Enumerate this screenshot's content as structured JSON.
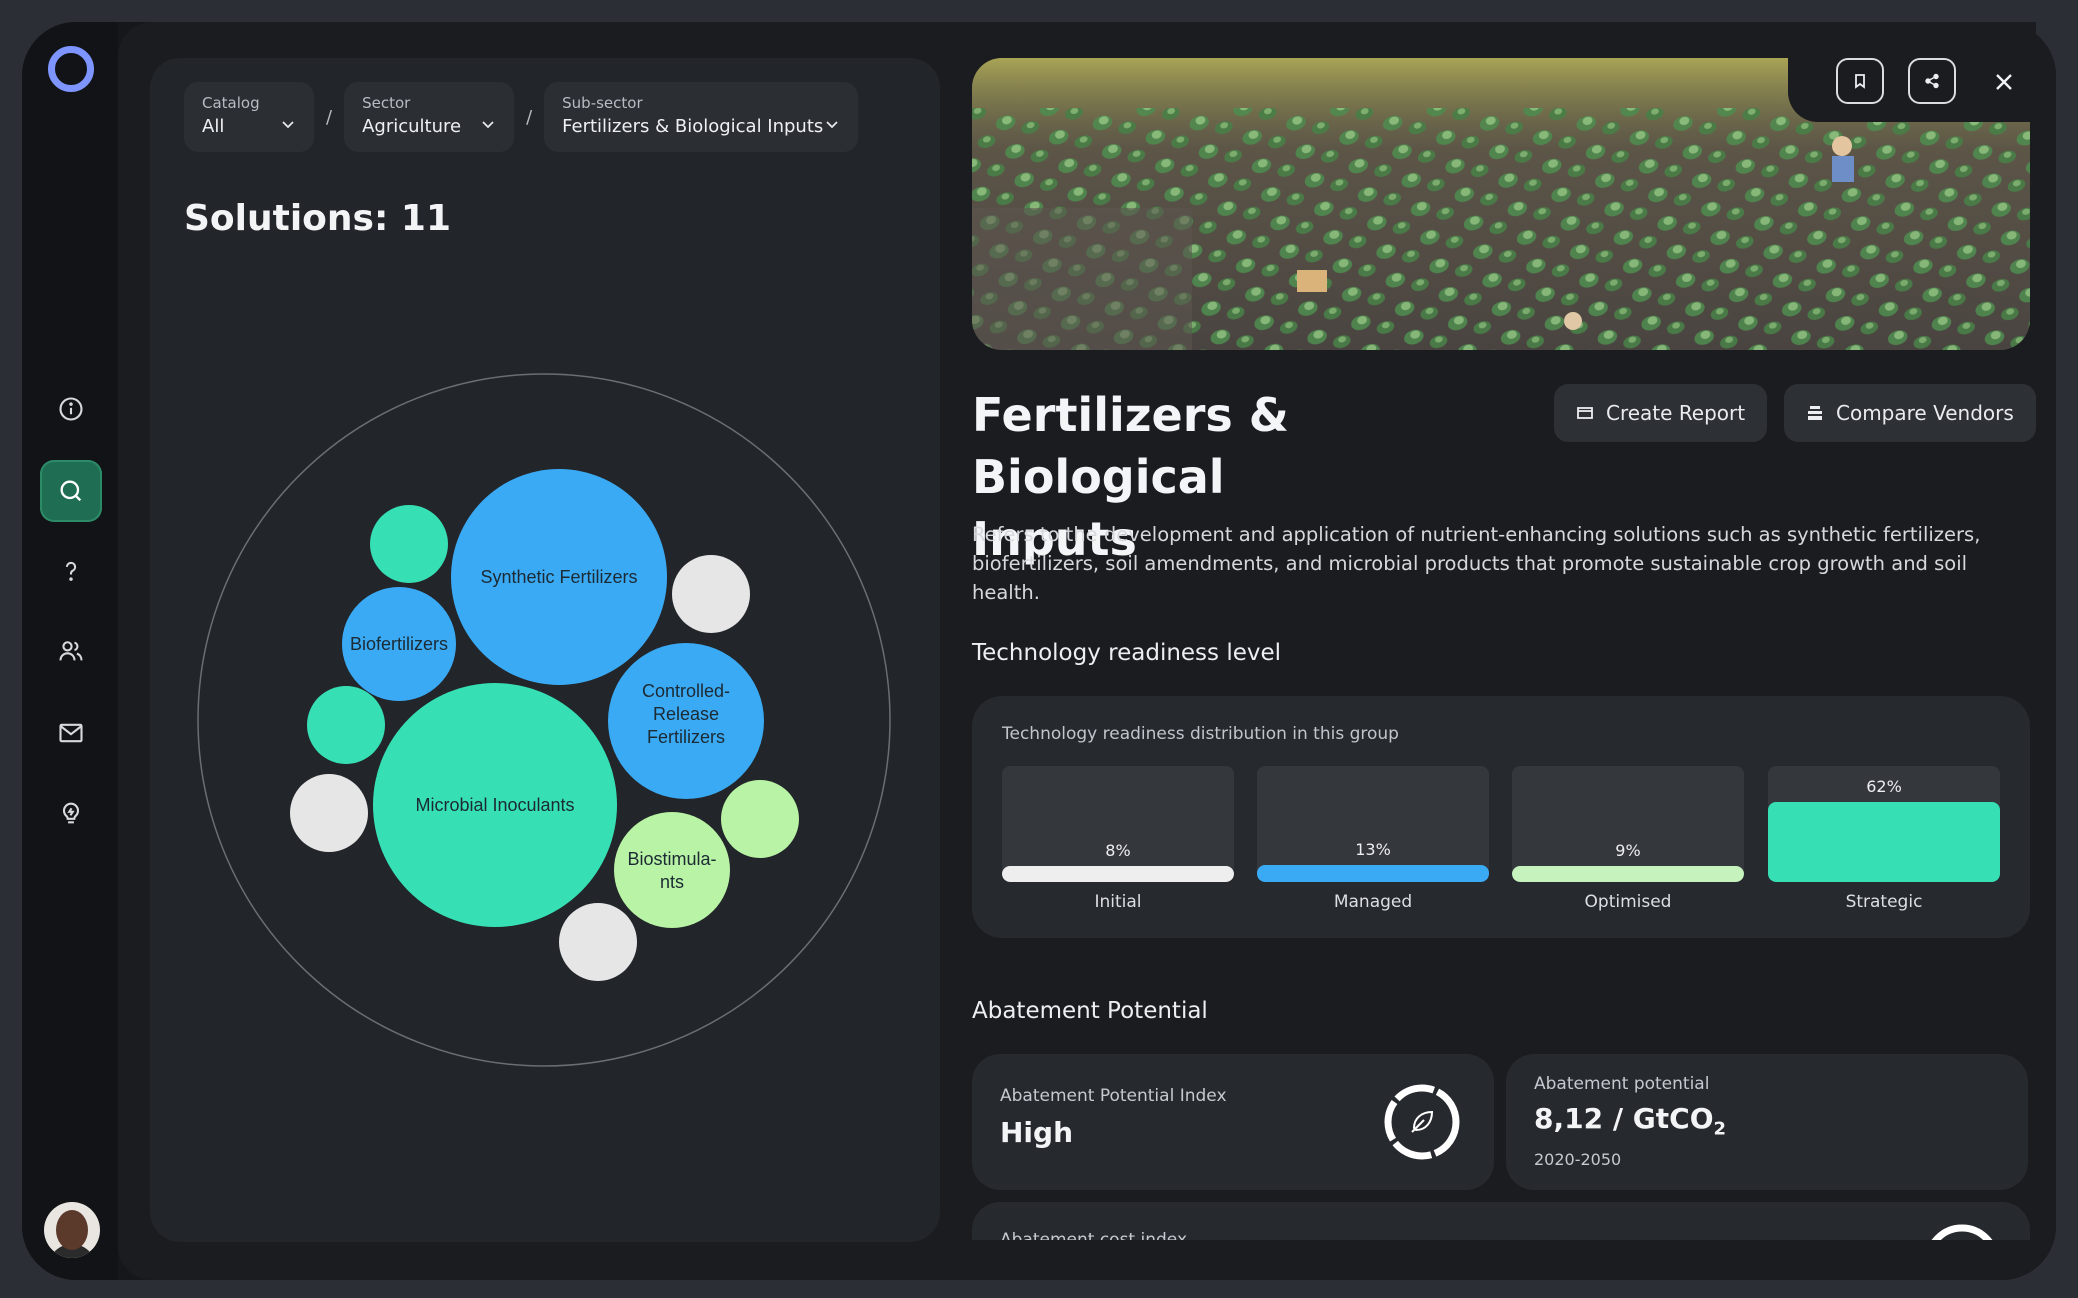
{
  "sidebar": {
    "logo_icon": "app-logo-icon",
    "items": [
      {
        "id": "info",
        "icon": "info-icon",
        "active": false
      },
      {
        "id": "search",
        "icon": "search-icon",
        "active": true
      },
      {
        "id": "help",
        "icon": "question-icon",
        "active": false
      },
      {
        "id": "users",
        "icon": "users-icon",
        "active": false
      },
      {
        "id": "mail",
        "icon": "mail-icon",
        "active": false
      },
      {
        "id": "ideas",
        "icon": "lightbulb-icon",
        "active": false
      }
    ],
    "avatar": "user-avatar"
  },
  "filters": {
    "catalog": {
      "label": "Catalog",
      "value": "All"
    },
    "sector": {
      "label": "Sector",
      "value": "Agriculture"
    },
    "subsector": {
      "label": "Sub-sector",
      "value": "Fertilizers & Biological Inputs"
    },
    "separator": "/"
  },
  "solutions": {
    "title": "Solutions: 11"
  },
  "bubbles": {
    "labels": {
      "synthetic": "Synthetic Fertilizers",
      "biofert": "Biofertilizers",
      "controlled_1": "Controlled-",
      "controlled_2": "Release",
      "controlled_3": "Fertilizers",
      "microbial": "Microbial Inoculants",
      "biostim_1": "Biostimula-",
      "biostim_2": "nts"
    },
    "colors": {
      "blue": "#3aaaf5",
      "green": "#36e0b4",
      "light_green": "#b9f3a6",
      "grey": "#e6e6e6"
    }
  },
  "detail": {
    "title_line1": "Fertilizers & Biological",
    "title_line2": "Inputs",
    "create_report": "Create Report",
    "compare_vendors": "Compare Vendors",
    "description": "Refers to the development and application of nutrient-enhancing solutions such as synthetic fertilizers, biofertilizers, soil amendments, and microbial products that promote sustainable crop growth and soil health."
  },
  "trl": {
    "heading": "Technology readiness level",
    "subtitle": "Technology readiness distribution in this group",
    "levels": [
      {
        "name": "Initial",
        "pct_label": "8%",
        "value": 8,
        "color": "#eeeeee"
      },
      {
        "name": "Managed",
        "pct_label": "13%",
        "value": 13,
        "color": "#3aaaf5"
      },
      {
        "name": "Optimised",
        "pct_label": "9%",
        "value": 9,
        "color": "#c6f2bd"
      },
      {
        "name": "Strategic",
        "pct_label": "62%",
        "value": 62,
        "color": "#36e0b4"
      }
    ]
  },
  "abatement": {
    "heading": "Abatement Potential",
    "index_label": "Abatement Potential Index",
    "index_value": "High",
    "potential_label": "Abatement potential",
    "potential_value": "8,12 / GtCO",
    "potential_sub": "2",
    "potential_years": "2020-2050",
    "cost_label": "Abatement cost index"
  }
}
